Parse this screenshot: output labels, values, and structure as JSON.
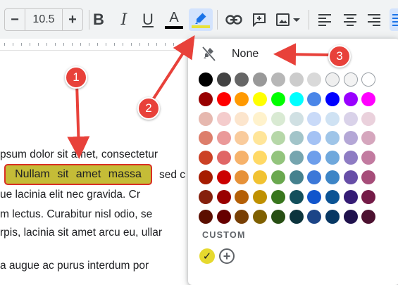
{
  "toolbar": {
    "font_size": "10.5",
    "minus_glyph": "−",
    "plus_glyph": "+",
    "bold_glyph": "B",
    "italic_glyph": "I",
    "underline_glyph": "U",
    "text_color_glyph": "A",
    "text_color_bar": "#000000",
    "highlight_bar": "#e8e13a",
    "icons": [
      "minus-icon",
      "plus-icon",
      "bold-icon",
      "italic-icon",
      "underline-icon",
      "text-color-icon",
      "highlight-pen-icon",
      "link-icon",
      "add-comment-icon",
      "insert-image-icon",
      "align-left-icon",
      "align-center-icon",
      "align-justify-icon"
    ]
  },
  "document": {
    "lines": [
      "psum dolor sit amet, consectetur",
      "sed c",
      "ue lacinia elit nec gravida. Cr",
      "m lectus. Curabitur nisl odio, se",
      "rpis, lacinia sit amet arcu eu, ullar",
      "a augue ac purus interdum por"
    ],
    "highlighted_text": "Nullam sit amet massa",
    "highlight_color": "#c5bc37"
  },
  "highlight_menu": {
    "none_label": "None",
    "custom_label": "CUSTOM",
    "custom_color": "#e6d92e",
    "add_custom_glyph": "+",
    "check_glyph": "✓",
    "palette": [
      [
        "#000000",
        "#434343",
        "#666666",
        "#999999",
        "#b7b7b7",
        "#cccccc",
        "#d9d9d9",
        "#efefef",
        "#f3f3f3",
        "#ffffff"
      ],
      [
        "#980000",
        "#ff0000",
        "#ff9900",
        "#ffff00",
        "#00ff00",
        "#00ffff",
        "#4a86e8",
        "#0000ff",
        "#9900ff",
        "#ff00ff"
      ],
      [
        "#e6b8af",
        "#f4cccc",
        "#fce5cd",
        "#fff2cc",
        "#d9ead3",
        "#d0e0e3",
        "#c9daf8",
        "#cfe2f3",
        "#d9d2e9",
        "#ead1dc"
      ],
      [
        "#dd7e6b",
        "#ea9999",
        "#f9cb9c",
        "#ffe599",
        "#b6d7a8",
        "#a2c4c9",
        "#a4c2f4",
        "#9fc5e8",
        "#b4a7d6",
        "#d5a6bd"
      ],
      [
        "#cc4125",
        "#e06666",
        "#f6b26b",
        "#ffd966",
        "#93c47d",
        "#76a5af",
        "#6d9eeb",
        "#6fa8dc",
        "#8e7cc3",
        "#c27ba0"
      ],
      [
        "#a61c00",
        "#cc0000",
        "#e69138",
        "#f1c232",
        "#6aa84f",
        "#45818e",
        "#3c78d8",
        "#3d85c6",
        "#674ea7",
        "#a64d79"
      ],
      [
        "#85200c",
        "#990000",
        "#b45f06",
        "#bf9000",
        "#38761d",
        "#134f5c",
        "#1155cc",
        "#0b5394",
        "#351c75",
        "#741b47"
      ],
      [
        "#5b0f00",
        "#660000",
        "#783f04",
        "#7f6000",
        "#274e13",
        "#0c343d",
        "#1c4587",
        "#073763",
        "#20124d",
        "#4c1130"
      ]
    ]
  },
  "annotations": {
    "markers": [
      "1",
      "2",
      "3"
    ],
    "marker_color": "#e8413a"
  }
}
